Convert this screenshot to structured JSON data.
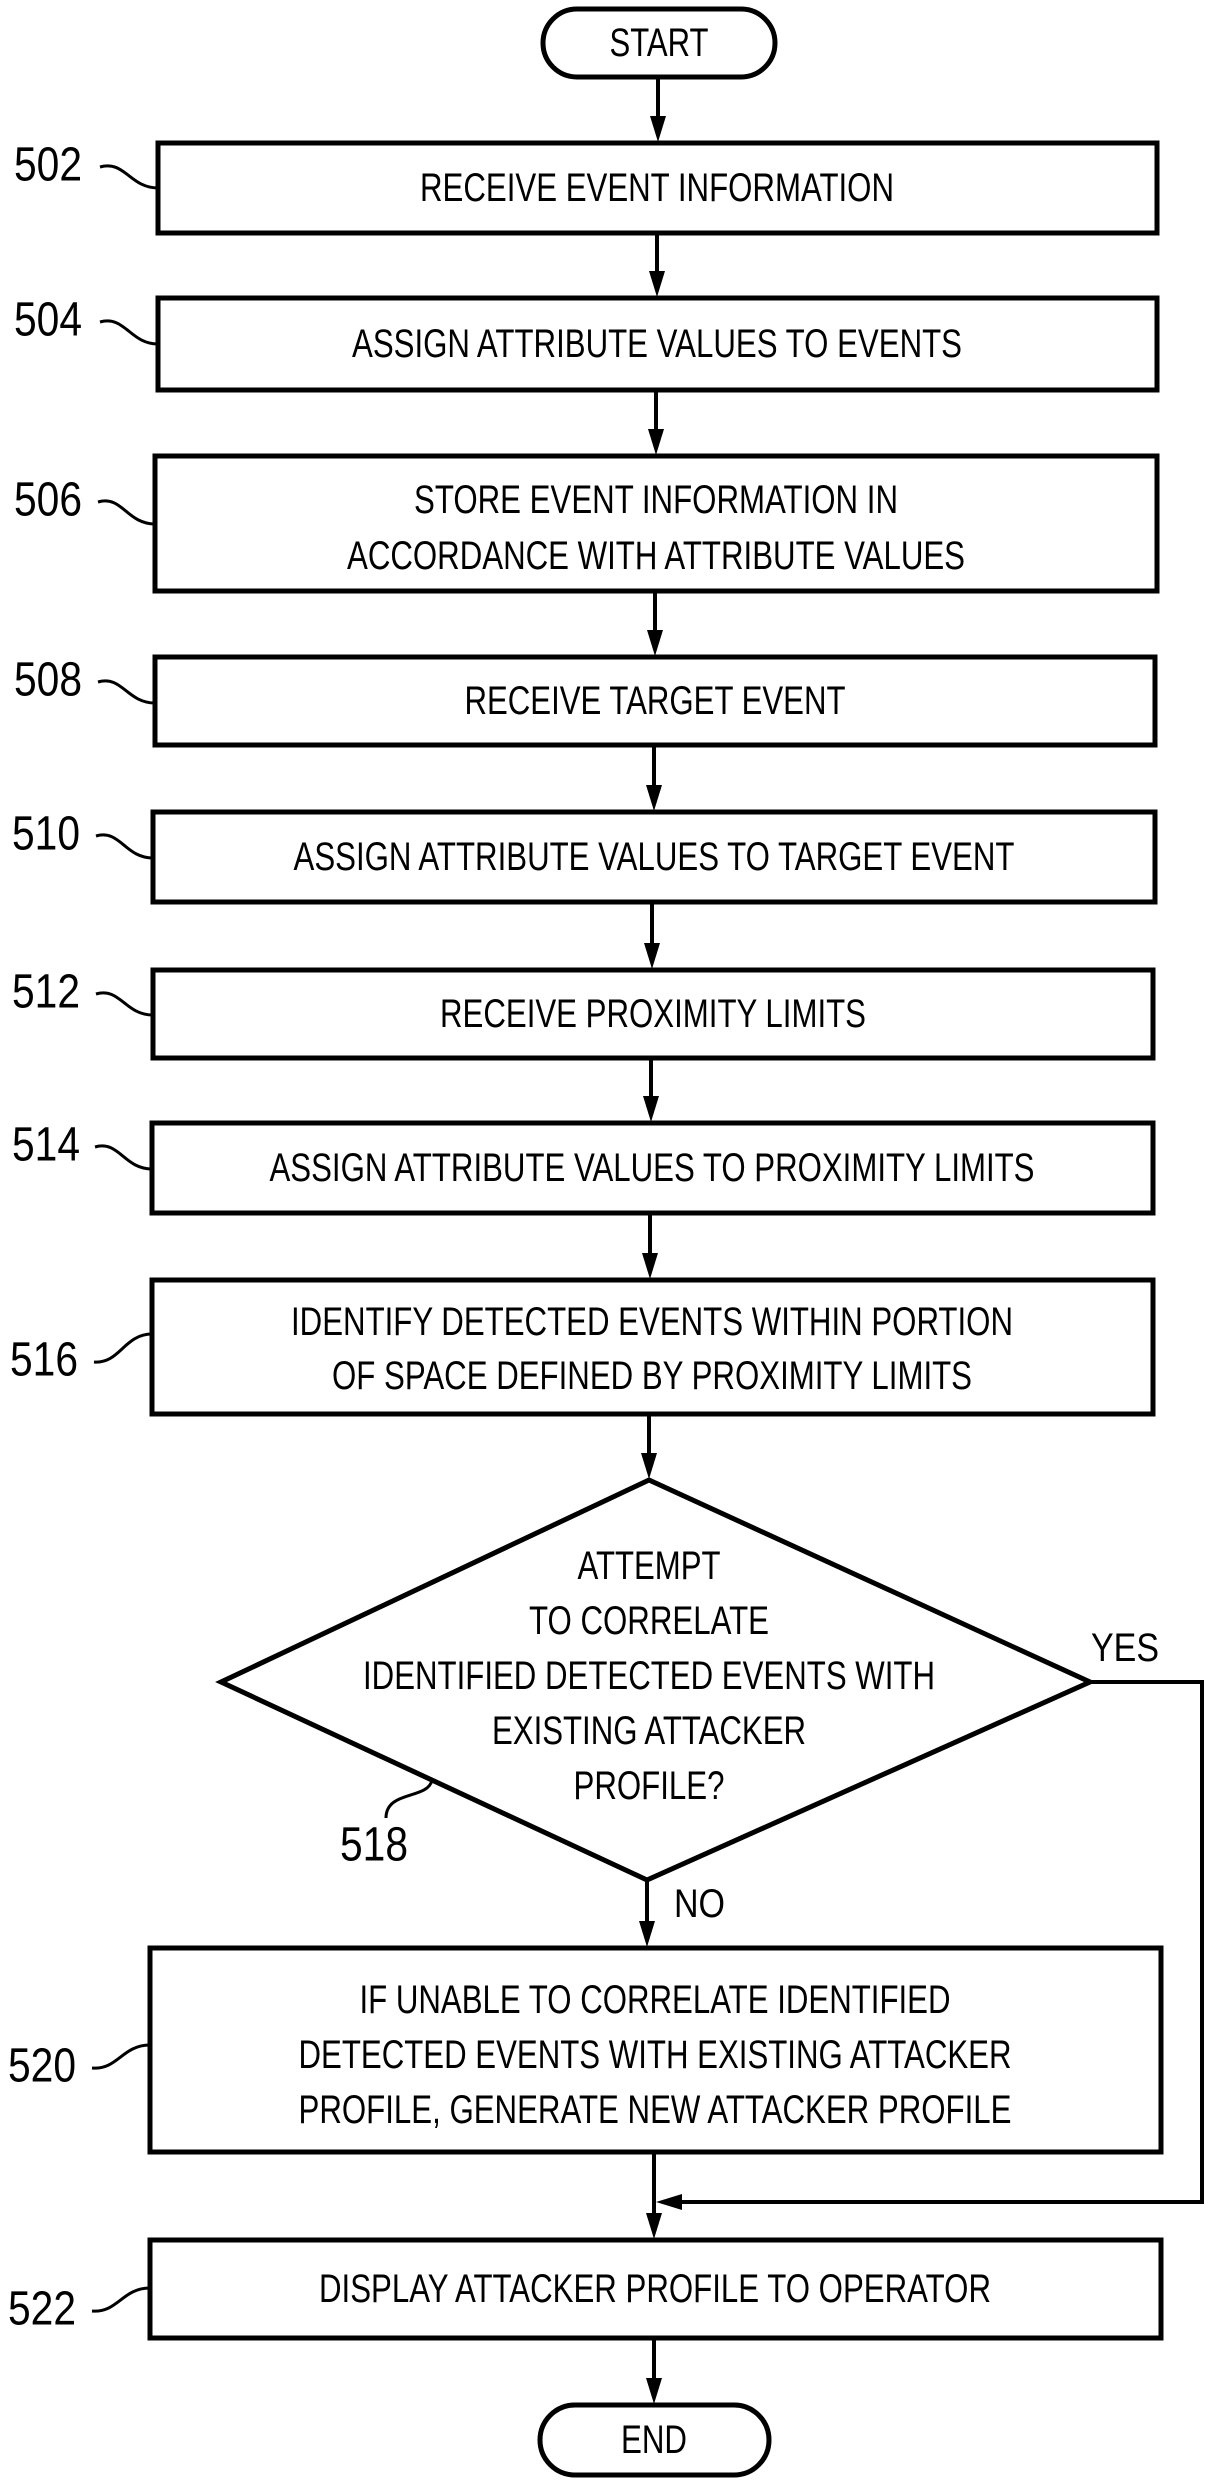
{
  "diagram": {
    "type": "flowchart",
    "start": {
      "label": "START"
    },
    "end": {
      "label": "END"
    },
    "steps": [
      {
        "ref": "502",
        "lines": [
          "RECEIVE EVENT INFORMATION"
        ]
      },
      {
        "ref": "504",
        "lines": [
          "ASSIGN ATTRIBUTE VALUES TO EVENTS"
        ]
      },
      {
        "ref": "506",
        "lines": [
          "STORE EVENT INFORMATION IN",
          "ACCORDANCE WITH ATTRIBUTE VALUES"
        ]
      },
      {
        "ref": "508",
        "lines": [
          "RECEIVE TARGET EVENT"
        ]
      },
      {
        "ref": "510",
        "lines": [
          "ASSIGN ATTRIBUTE VALUES TO TARGET EVENT"
        ]
      },
      {
        "ref": "512",
        "lines": [
          "RECEIVE PROXIMITY LIMITS"
        ]
      },
      {
        "ref": "514",
        "lines": [
          "ASSIGN ATTRIBUTE VALUES TO PROXIMITY LIMITS"
        ]
      },
      {
        "ref": "516",
        "lines": [
          "IDENTIFY DETECTED EVENTS WITHIN PORTION",
          "OF SPACE DEFINED BY PROXIMITY LIMITS"
        ]
      }
    ],
    "decision": {
      "ref": "518",
      "lines": [
        "ATTEMPT",
        "TO CORRELATE",
        "IDENTIFIED DETECTED EVENTS WITH",
        "EXISTING ATTACKER",
        "PROFILE?"
      ],
      "yes_label": "YES",
      "no_label": "NO"
    },
    "after_decision": [
      {
        "ref": "520",
        "lines": [
          "IF UNABLE TO CORRELATE IDENTIFIED",
          "DETECTED EVENTS WITH EXISTING ATTACKER",
          "PROFILE, GENERATE NEW ATTACKER PROFILE"
        ]
      },
      {
        "ref": "522",
        "lines": [
          "DISPLAY ATTACKER PROFILE TO OPERATOR"
        ]
      }
    ]
  }
}
